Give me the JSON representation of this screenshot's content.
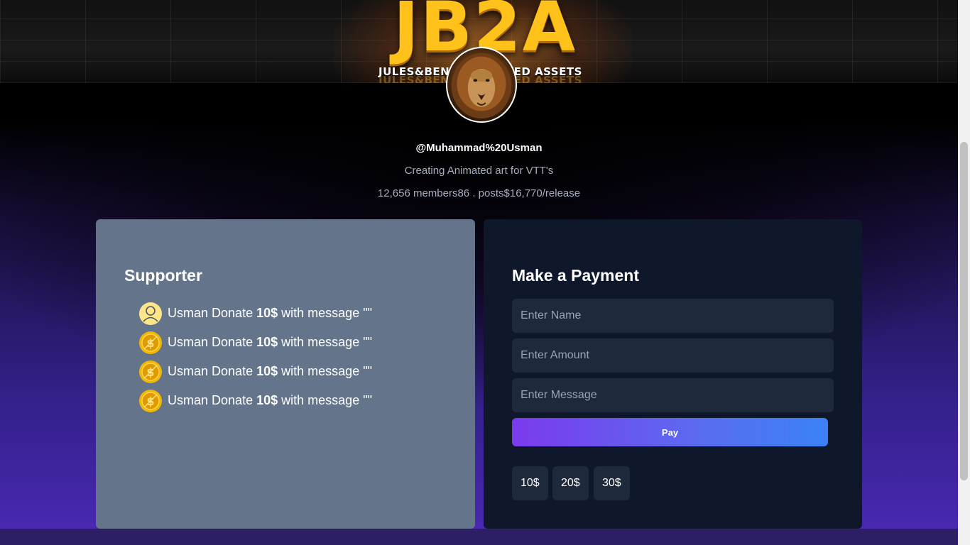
{
  "banner": {
    "logo_text": "JB2A",
    "subtitle": "JULES&BEN'S ANIMATED ASSETS"
  },
  "profile": {
    "handle": "@Muhammad%20Usman",
    "description": "Creating Animated art for VTT's",
    "stats": "12,656 members86 . posts$16,770/release"
  },
  "supporters": {
    "title": "Supporter",
    "items": [
      {
        "icon": "user-avatar-icon",
        "name": "Usman",
        "verb": "Donate",
        "amount": "10$",
        "suffix": "with message \"\""
      },
      {
        "icon": "coin-icon",
        "name": "Usman",
        "verb": "Donate",
        "amount": "10$",
        "suffix": "with message \"\""
      },
      {
        "icon": "coin-icon",
        "name": "Usman",
        "verb": "Donate",
        "amount": "10$",
        "suffix": "with message \"\""
      },
      {
        "icon": "coin-icon",
        "name": "Usman",
        "verb": "Donate",
        "amount": "10$",
        "suffix": "with message \"\""
      }
    ]
  },
  "payment": {
    "title": "Make a Payment",
    "name_placeholder": "Enter Name",
    "amount_placeholder": "Enter Amount",
    "message_placeholder": "Enter Message",
    "pay_label": "Pay",
    "quick_amounts": [
      "10$",
      "20$",
      "30$"
    ]
  },
  "colors": {
    "supporter_card": "#64748b",
    "payment_card": "#0f172a",
    "input_bg": "#1e293b",
    "pay_gradient_start": "#7c3aed",
    "pay_gradient_end": "#3b82f6"
  }
}
